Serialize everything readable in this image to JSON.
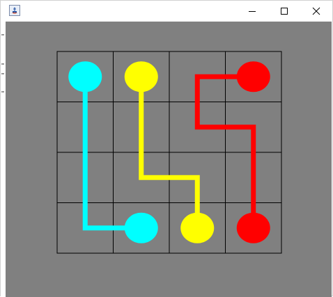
{
  "window": {
    "controls": {
      "minimize_icon": "minimize-icon",
      "maximize_icon": "maximize-icon",
      "close_icon": "close-icon"
    }
  },
  "game": {
    "grid": {
      "rows": 4,
      "cols": 4
    },
    "colors": {
      "background": "#808080",
      "grid_lines": "#000000",
      "cyan": "#00FFFF",
      "yellow": "#FFFF00",
      "red": "#FF0000"
    },
    "dots": [
      {
        "color": "cyan",
        "row": 0,
        "col": 0
      },
      {
        "color": "cyan",
        "row": 3,
        "col": 1
      },
      {
        "color": "yellow",
        "row": 0,
        "col": 1
      },
      {
        "color": "yellow",
        "row": 3,
        "col": 2
      },
      {
        "color": "red",
        "row": 0,
        "col": 3
      },
      {
        "color": "red",
        "row": 3,
        "col": 3
      }
    ],
    "paths": [
      {
        "color": "cyan",
        "cells": [
          [
            0,
            0
          ],
          [
            1,
            0
          ],
          [
            2,
            0
          ],
          [
            3,
            0
          ],
          [
            3,
            1
          ]
        ]
      },
      {
        "color": "yellow",
        "cells": [
          [
            0,
            1
          ],
          [
            1,
            1
          ],
          [
            2,
            1
          ],
          [
            2,
            2
          ],
          [
            3,
            2
          ]
        ]
      },
      {
        "color": "red",
        "cells": [
          [
            0,
            3
          ],
          [
            0,
            2
          ],
          [
            1,
            2
          ],
          [
            1,
            3
          ],
          [
            2,
            3
          ],
          [
            3,
            3
          ]
        ]
      }
    ]
  }
}
